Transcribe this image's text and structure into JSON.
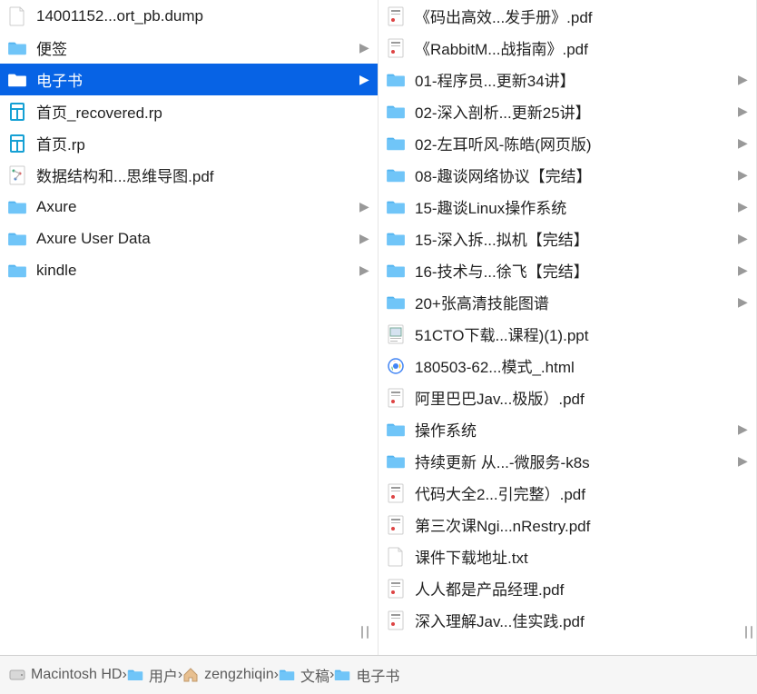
{
  "columns": [
    {
      "items": [
        {
          "icon": "file-generic",
          "label": "14001152...ort_pb.dump",
          "folder": false,
          "selected": false
        },
        {
          "icon": "folder",
          "label": "便签",
          "folder": true,
          "selected": false
        },
        {
          "icon": "folder",
          "label": "电子书",
          "folder": true,
          "selected": true
        },
        {
          "icon": "file-rp",
          "label": "首页_recovered.rp",
          "folder": false,
          "selected": false
        },
        {
          "icon": "file-rp",
          "label": "首页.rp",
          "folder": false,
          "selected": false
        },
        {
          "icon": "file-pdf-map",
          "label": "数据结构和...思维导图.pdf",
          "folder": false,
          "selected": false
        },
        {
          "icon": "folder",
          "label": "Axure",
          "folder": true,
          "selected": false
        },
        {
          "icon": "folder",
          "label": "Axure User Data",
          "folder": true,
          "selected": false
        },
        {
          "icon": "folder",
          "label": "kindle",
          "folder": true,
          "selected": false
        }
      ]
    },
    {
      "items": [
        {
          "icon": "file-pdf",
          "label": "《码出高效...发手册》.pdf",
          "folder": false
        },
        {
          "icon": "file-pdf",
          "label": "《RabbitM...战指南》.pdf",
          "folder": false
        },
        {
          "icon": "folder",
          "label": "01-程序员...更新34讲】",
          "folder": true
        },
        {
          "icon": "folder",
          "label": "02-深入剖析...更新25讲】",
          "folder": true
        },
        {
          "icon": "folder",
          "label": "02-左耳听风-陈皓(网页版)",
          "folder": true
        },
        {
          "icon": "folder",
          "label": "08-趣谈网络协议【完结】",
          "folder": true
        },
        {
          "icon": "folder",
          "label": "15-趣谈Linux操作系统",
          "folder": true
        },
        {
          "icon": "folder",
          "label": "15-深入拆...拟机【完结】",
          "folder": true
        },
        {
          "icon": "folder",
          "label": "16-技术与...徐飞【完结】",
          "folder": true
        },
        {
          "icon": "folder",
          "label": "20+张高清技能图谱",
          "folder": true
        },
        {
          "icon": "file-ppt",
          "label": "51CTO下载...课程)(1).ppt",
          "folder": false
        },
        {
          "icon": "file-html",
          "label": "180503-62...模式_.html",
          "folder": false
        },
        {
          "icon": "file-pdf",
          "label": "阿里巴巴Jav...极版）.pdf",
          "folder": false
        },
        {
          "icon": "folder",
          "label": "操作系统",
          "folder": true
        },
        {
          "icon": "folder",
          "label": "持续更新 从...-微服务-k8s",
          "folder": true
        },
        {
          "icon": "file-pdf",
          "label": "代码大全2...引完整）.pdf",
          "folder": false
        },
        {
          "icon": "file-pdf",
          "label": "第三次课Ngi...nRestry.pdf",
          "folder": false
        },
        {
          "icon": "file-txt",
          "label": "课件下载地址.txt",
          "folder": false
        },
        {
          "icon": "file-pdf",
          "label": "人人都是产品经理.pdf",
          "folder": false
        },
        {
          "icon": "file-pdf",
          "label": "深入理解Jav...佳实践.pdf",
          "folder": false
        }
      ]
    }
  ],
  "path": [
    {
      "icon": "disk",
      "label": "Macintosh HD"
    },
    {
      "icon": "folder",
      "label": "用户"
    },
    {
      "icon": "home",
      "label": "zengzhiqin"
    },
    {
      "icon": "folder",
      "label": "文稿"
    },
    {
      "icon": "folder",
      "label": "电子书"
    }
  ],
  "glyphs": {
    "chevron": "▶",
    "sep": "›"
  }
}
